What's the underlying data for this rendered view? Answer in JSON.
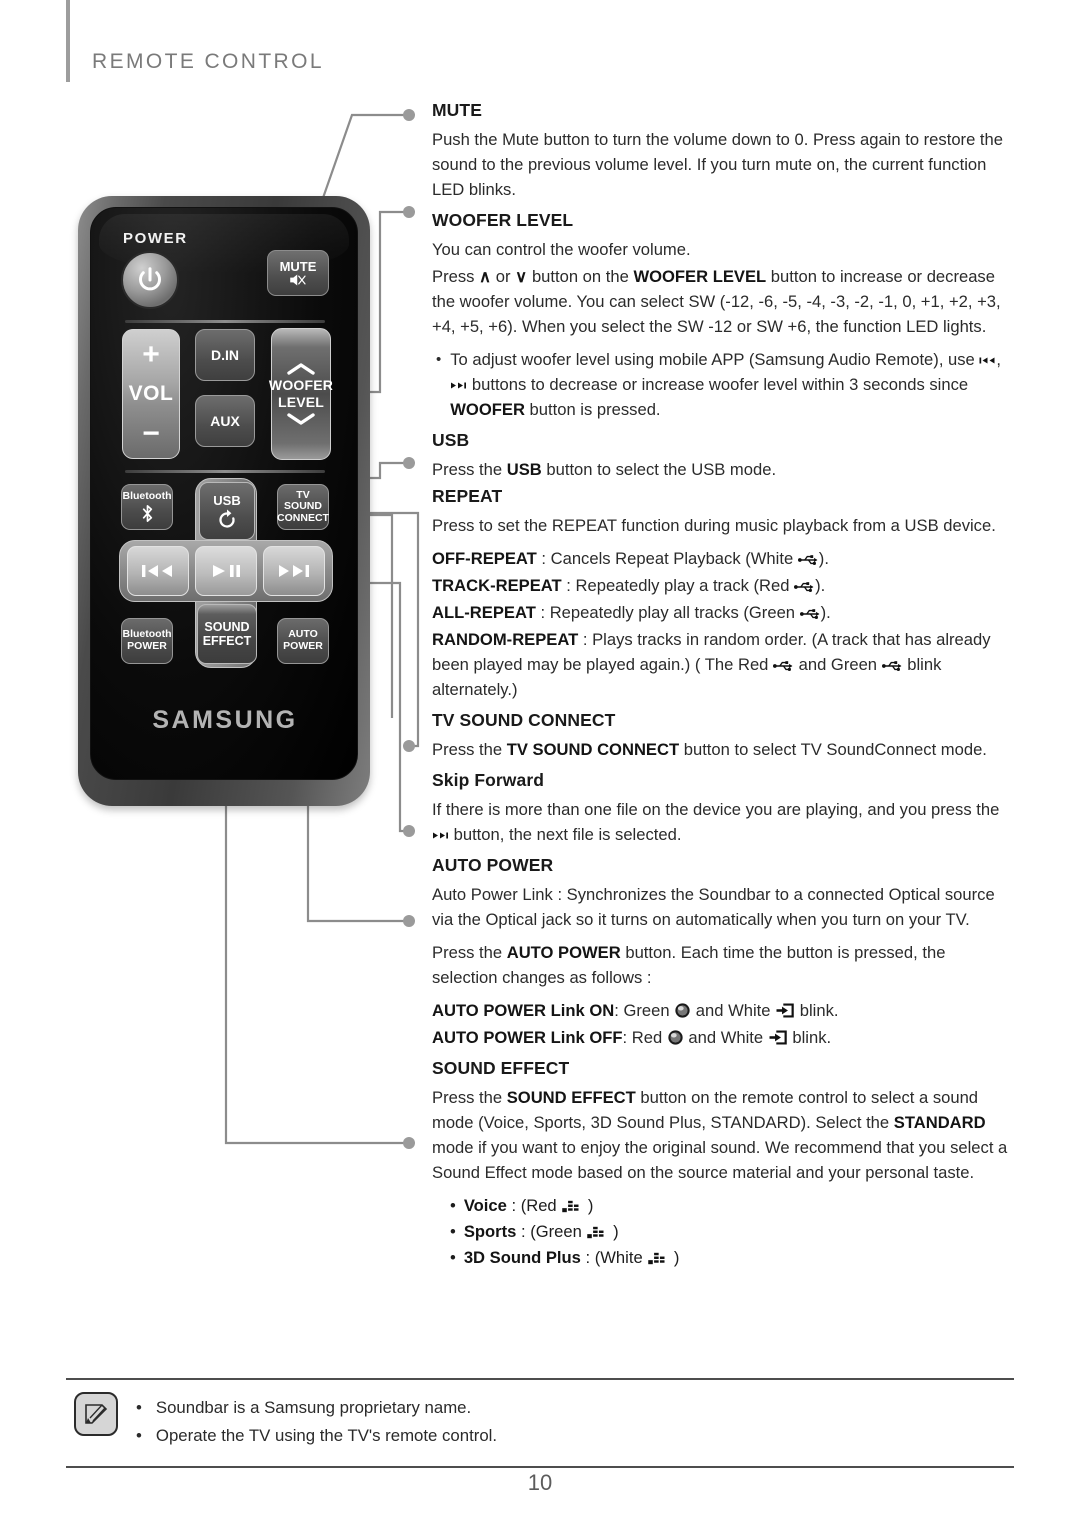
{
  "header": {
    "title": "REMOTE CONTROL"
  },
  "remote": {
    "power_label": "POWER",
    "power_icon": "power-icon",
    "mute_label": "MUTE",
    "mute_icon": "mute-speaker-icon",
    "vol_label": "VOL",
    "vol_plus": "+",
    "vol_minus": "−",
    "din_label": "D.IN",
    "aux_label": "AUX",
    "woofer_line1": "WOOFER",
    "woofer_line2": "LEVEL",
    "woofer_up_icon": "chevron-up-icon",
    "woofer_down_icon": "chevron-down-icon",
    "bluetooth_label": "Bluetooth",
    "bluetooth_icon": "bluetooth-icon",
    "usb_label": "USB",
    "usb_icon": "repeat-loop-icon",
    "tv_sound_line1": "TV SOUND",
    "tv_sound_line2": "CONNECT",
    "prev_icon": "skip-back-icon",
    "play_icon": "play-pause-icon",
    "next_icon": "skip-forward-icon",
    "bt_power_line1": "Bluetooth",
    "bt_power_line2": "POWER",
    "sound_effect_line1": "SOUND",
    "sound_effect_line2": "EFFECT",
    "auto_power_line1": "AUTO",
    "auto_power_line2": "POWER",
    "brand": "SAMSUNG"
  },
  "sections": {
    "mute": {
      "title": "MUTE",
      "body": "Push the Mute button to turn the volume down to 0. Press again to restore the sound to the previous volume level. If you turn mute on, the current function LED blinks."
    },
    "woofer": {
      "title": "WOOFER LEVEL",
      "p1": "You can control the woofer volume.",
      "p2_a": "Press ",
      "p2_up": "∧",
      "p2_b": " or ",
      "p2_down": "∨",
      "p2_c": " button on the ",
      "p2_bold": "WOOFER LEVEL",
      "p2_d": " button to increase or decrease the woofer volume. You can select SW (-12, -6, -5, -4, -3, -2, -1, 0, +1, +2, +3, +4, +5, +6). When you select the SW -12  or SW +6, the function LED lights.",
      "bullet_a": "To adjust woofer level using mobile APP (Samsung Audio Remote), use ",
      "bullet_b": ", ",
      "bullet_c": " buttons to decrease or increase woofer level within 3 seconds since ",
      "bullet_bold": "WOOFER",
      "bullet_d": " button is pressed."
    },
    "usb": {
      "title": "USB",
      "p_a": "Press the ",
      "p_bold": "USB",
      "p_b": " button to select the USB mode."
    },
    "repeat": {
      "title": "REPEAT",
      "body": "Press to set the REPEAT function during music playback from a USB device.",
      "off_label": "OFF-REPEAT",
      "off_text": " : Cancels Repeat Playback (White ",
      "off_tail": ").",
      "track_label": "TRACK-REPEAT",
      "track_text": " : Repeatedly play a track (Red ",
      "track_tail": ").",
      "all_label": "ALL-REPEAT",
      "all_text": " : Repeatedly play all tracks (Green ",
      "all_tail": ").",
      "random_label": "RANDOM-REPEAT",
      "random_text": " : Plays tracks in random order. (A track that has already been played may be played again.) ( The Red ",
      "random_mid": " and Green ",
      "random_tail": " blink alternately.)"
    },
    "tv_sound": {
      "title": "TV SOUND CONNECT",
      "p_a": "Press the ",
      "p_bold": "TV SOUND CONNECT",
      "p_b": " button to select TV SoundConnect mode."
    },
    "skip_forward": {
      "title": "Skip Forward",
      "p_a": "If there is more than one file on the device you are playing, and you press the ",
      "p_b": " button, the next file is selected."
    },
    "auto_power": {
      "title": "AUTO POWER",
      "p1": "Auto Power Link : Synchronizes the Soundbar to a connected Optical source via the Optical jack so it turns on automatically when you turn on your TV.",
      "p2_a": "Press the ",
      "p2_bold": "AUTO POWER",
      "p2_b": " button. Each time the button is pressed, the selection changes as follows :",
      "on_label": "AUTO POWER Link ON",
      "on_text": ": Green ",
      "on_mid": " and White ",
      "on_tail": " blink.",
      "off_label": "AUTO POWER Link OFF",
      "off_text": ": Red ",
      "off_mid": " and White ",
      "off_tail": " blink."
    },
    "sound_effect": {
      "title": "SOUND EFFECT",
      "p_a": "Press the ",
      "p_bold1": "SOUND EFFECT",
      "p_b": " button on the remote control to select a sound mode (Voice, Sports, 3D Sound Plus, STANDARD). Select the ",
      "p_bold2": "STANDARD",
      "p_c": " mode if you want to enjoy the original sound. We recommend that you select a Sound Effect mode based on the source material and your personal taste.",
      "voice_label": "Voice",
      "voice_text": " : (Red ",
      "sports_label": "Sports",
      "sports_text": " : (Green ",
      "plus_label": "3D Sound Plus",
      "plus_text": " : (White ",
      "tail": " )"
    }
  },
  "note": {
    "icon": "note-pencil-icon",
    "lines": [
      "Soundbar is a Samsung proprietary name.",
      "Operate the TV using the TV's remote control."
    ]
  },
  "page_number": "10",
  "colors": {
    "header_text": "#7a7a7a",
    "body_text": "#2b2b2b",
    "leader_line": "#8c8c8c",
    "rule": "#4d4d4d"
  }
}
